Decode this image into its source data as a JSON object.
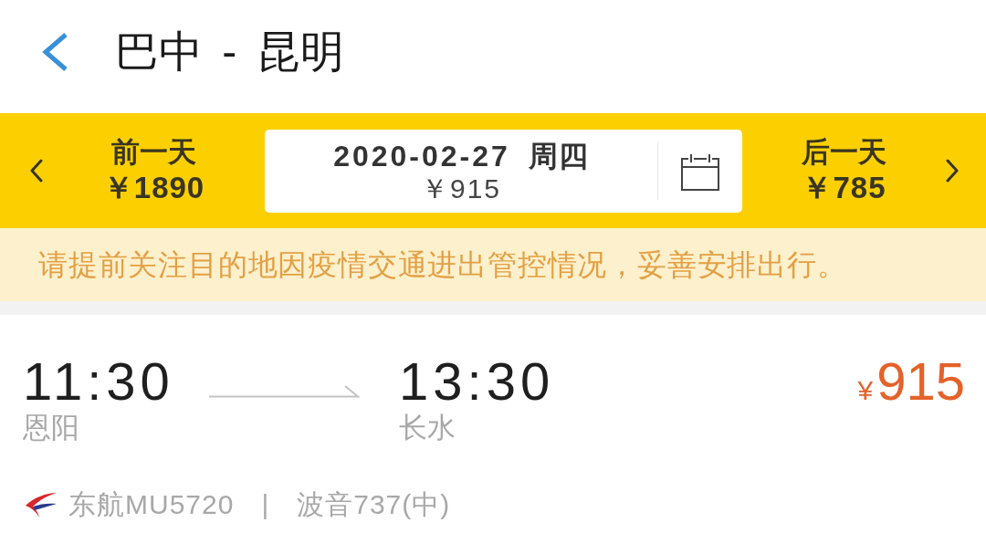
{
  "header": {
    "title": "巴中 - 昆明"
  },
  "date_bar": {
    "previous_day": {
      "label": "前一天",
      "price": "￥1890"
    },
    "current_day": {
      "date": "2020-02-27",
      "weekday": "周四",
      "price": "￥915"
    },
    "next_day": {
      "label": "后一天",
      "price": "￥785"
    }
  },
  "notice": "请提前关注目的地因疫情交通进出管控情况，妥善安排出行。",
  "flights": [
    {
      "departure_time": "11:30",
      "departure_airport": "恩阳",
      "arrival_time": "13:30",
      "arrival_airport": "长水",
      "price_symbol": "¥",
      "price": "915",
      "airline_flight": "东航MU5720",
      "separator": "|",
      "aircraft": "波音737(中)"
    }
  ]
}
